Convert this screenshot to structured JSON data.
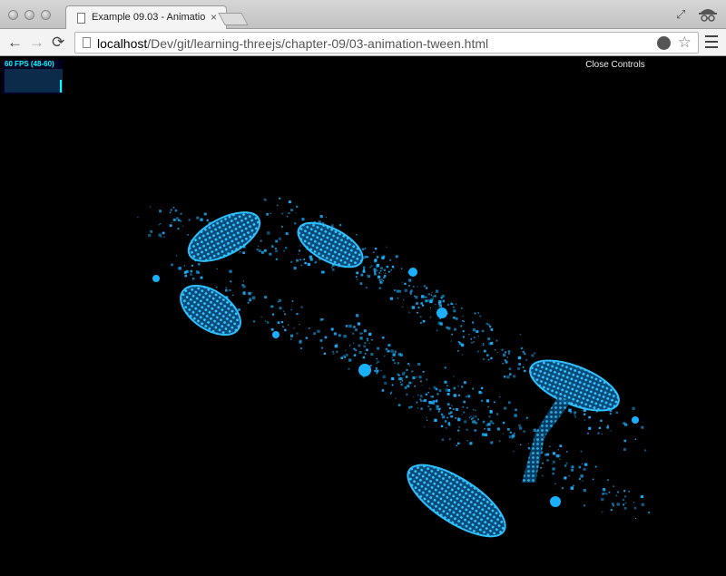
{
  "browser": {
    "tab_title": "Example 09.03 - Animatio",
    "tab_close": "×",
    "url_host": "localhost",
    "url_path": "/Dev/git/learning-threejs/chapter-09/03-animation-tween.html"
  },
  "toolbar": {
    "back": "←",
    "forward": "→",
    "reload": "⟳",
    "star": "☆"
  },
  "stats": {
    "fps_text": "60 FPS (48-60)"
  },
  "controls": {
    "close_label": "Close Controls"
  },
  "scene": {
    "particle_color": "#1ab0ff",
    "background": "#000000"
  }
}
